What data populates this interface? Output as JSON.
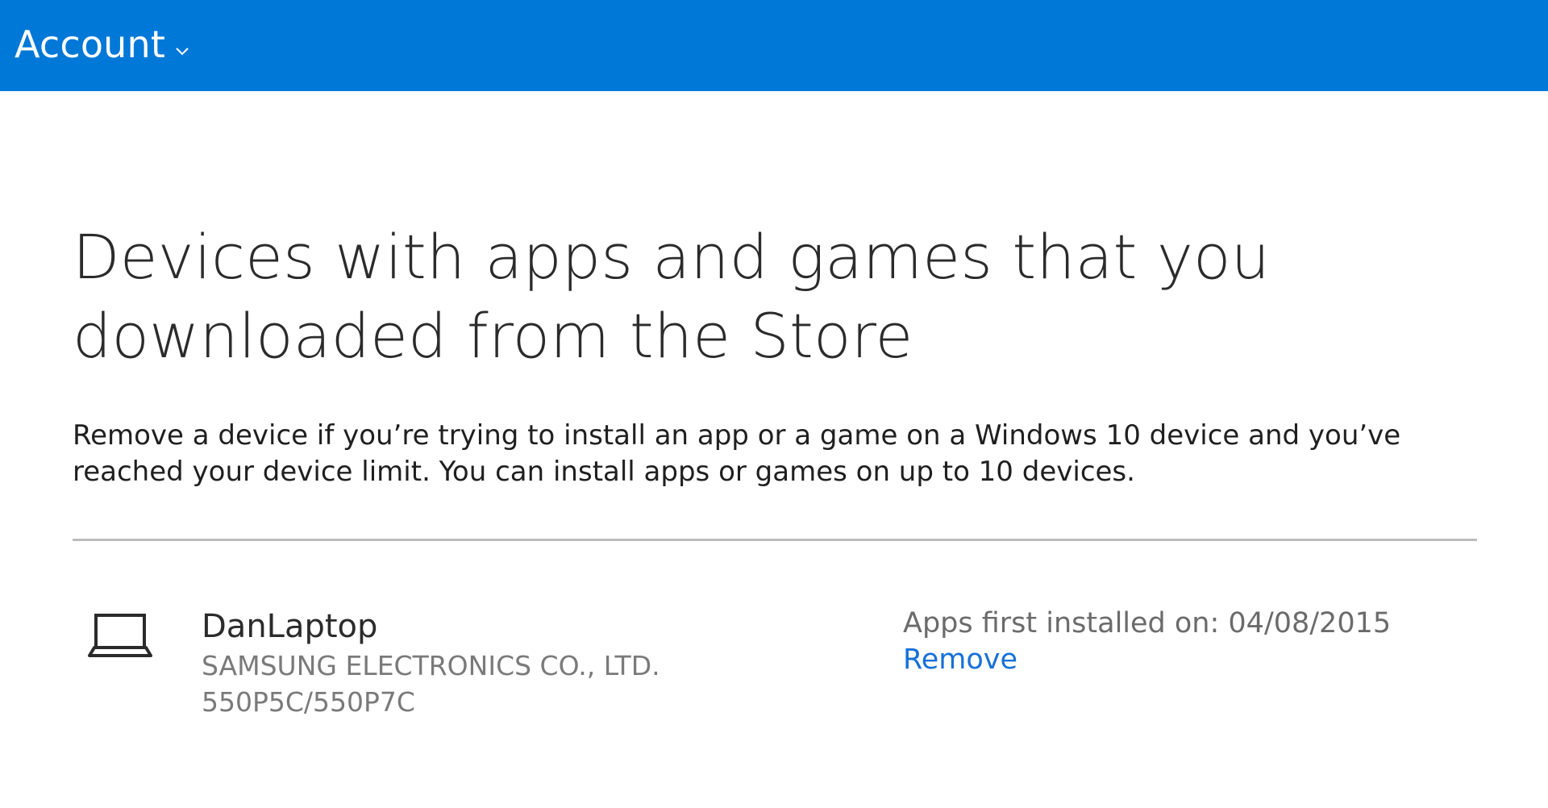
{
  "header": {
    "account_label": "Account",
    "background_color": "#0078d7",
    "icon": "chevron-down-icon"
  },
  "main": {
    "title": "Devices with apps and games that you downloaded from the Store",
    "description": "Remove a device if you’re trying to install an app or a game on a Windows 10 device and you’ve reached your device limit. You can install apps or games on up to 10 devices.",
    "devices": [
      {
        "icon": "laptop-icon",
        "name": "DanLaptop",
        "manufacturer": "SAMSUNG ELECTRONICS CO., LTD.",
        "model": "550P5C/550P7C",
        "installed_on": "Apps first installed on: 04/08/2015",
        "remove_label": "Remove"
      }
    ]
  },
  "colors": {
    "link": "#1670d8",
    "muted_text": "#7a7a7a"
  }
}
